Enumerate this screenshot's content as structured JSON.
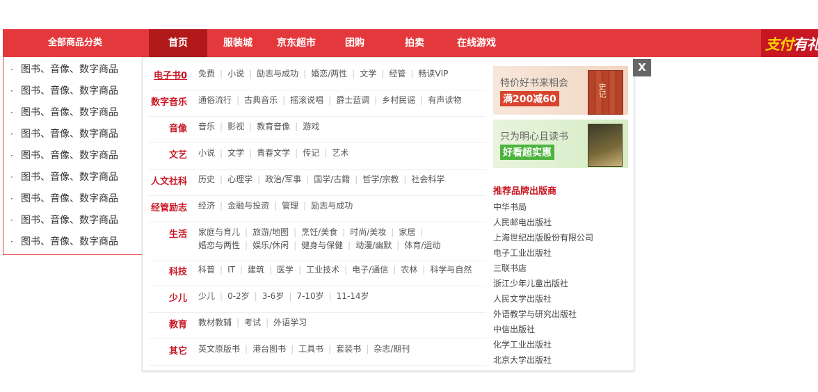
{
  "nav": {
    "category_title": "全部商品分类",
    "items": [
      "首页",
      "服装城",
      "京东超市",
      "团购",
      "拍卖",
      "在线游戏"
    ],
    "promo": {
      "part1": "支付",
      "part2": "有礼"
    }
  },
  "category_list": {
    "items": [
      "图书、音像、数字商品",
      "图书、音像、数字商品",
      "图书、音像、数字商品",
      "图书、音像、数字商品",
      "图书、音像、数字商品",
      "图书、音像、数字商品",
      "图书、音像、数字商品",
      "图书、音像、数字商品",
      "图书、音像、数字商品"
    ]
  },
  "popup": {
    "close_label": "X",
    "subcategories": [
      {
        "title": "电子书0",
        "links": [
          "免费",
          "小说",
          "励志与成功",
          "婚恋/两性",
          "文学",
          "经管",
          "畅读VIP"
        ]
      },
      {
        "title": "数字音乐",
        "links": [
          "通俗流行",
          "古典音乐",
          "摇滚说唱",
          "爵士蓝调",
          "乡村民谣",
          "有声读物"
        ]
      },
      {
        "title": "音像",
        "links": [
          "音乐",
          "影视",
          "教育音像",
          "游戏"
        ]
      },
      {
        "title": "文艺",
        "links": [
          "小说",
          "文学",
          "青春文学",
          "传记",
          "艺术"
        ]
      },
      {
        "title": "人文社科",
        "links": [
          "历史",
          "心理学",
          "政治/军事",
          "国学/古籍",
          "哲学/宗教",
          "社会科学"
        ]
      },
      {
        "title": "经管励志",
        "links": [
          "经济",
          "金融与投资",
          "管理",
          "励志与成功"
        ]
      },
      {
        "title": "生活",
        "links": [
          "家庭与育儿",
          "旅游/地图",
          "烹饪/美食",
          "时尚/美妆",
          "家居",
          "婚恋与两性",
          "娱乐/休闲",
          "健身与保健",
          "动漫/幽默",
          "体育/运动"
        ]
      },
      {
        "title": "科技",
        "links": [
          "科普",
          "IT",
          "建筑",
          "医学",
          "工业技术",
          "电子/通信",
          "农林",
          "科学与自然"
        ]
      },
      {
        "title": "少儿",
        "links": [
          "少儿",
          "0-2岁",
          "3-6岁",
          "7-10岁",
          "11-14岁"
        ]
      },
      {
        "title": "教育",
        "links": [
          "教材教辅",
          "考试",
          "外语学习"
        ]
      },
      {
        "title": "其它",
        "links": [
          "英文原版书",
          "港台图书",
          "工具书",
          "套装书",
          "杂志/期刊"
        ]
      }
    ],
    "ads": [
      {
        "line1": "特价好书来相会",
        "line2": "满200减60",
        "book_title": "史记"
      },
      {
        "line1": "只为明心且读书",
        "line2": "好看超实惠"
      }
    ],
    "publishers_title": "推荐品牌出版商",
    "publishers": [
      "中华书局",
      "人民邮电出版社",
      "上海世纪出版股份有限公司",
      "电子工业出版社",
      "三联书店",
      "浙江少年儿童出版社",
      "人民文学出版社",
      "外语教学与研究出版社",
      "中信出版社",
      "化学工业出版社",
      "北京大学出版社"
    ]
  },
  "colors": {
    "accent": "#e4393c",
    "active_nav": "#b1191a",
    "subcategory_title": "#c81623"
  }
}
